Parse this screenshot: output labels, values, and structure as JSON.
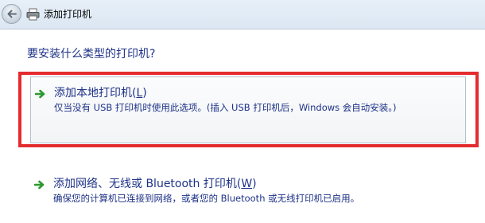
{
  "window": {
    "title": "添加打印机"
  },
  "prompt": {
    "question": "要安装什么类型的打印机?"
  },
  "options": [
    {
      "title_prefix": "添加本地打印机(",
      "hotkey": "L",
      "title_suffix": ")",
      "description": "仅当没有 USB 打印机时使用此选项。(插入 USB 打印机后，Windows 会自动安装。)",
      "icon": "green-arrow-icon"
    },
    {
      "title_prefix": "添加网络、无线或 Bluetooth 打印机(",
      "hotkey": "W",
      "title_suffix": ")",
      "description": "确保您的计算机已连接到网络，或者您的 Bluetooth 或无线打印机已启用。",
      "icon": "green-arrow-icon"
    }
  ],
  "colors": {
    "link_text": "#1e3287",
    "highlight": "#e42c2f",
    "arrow": "#2e9a2e"
  }
}
